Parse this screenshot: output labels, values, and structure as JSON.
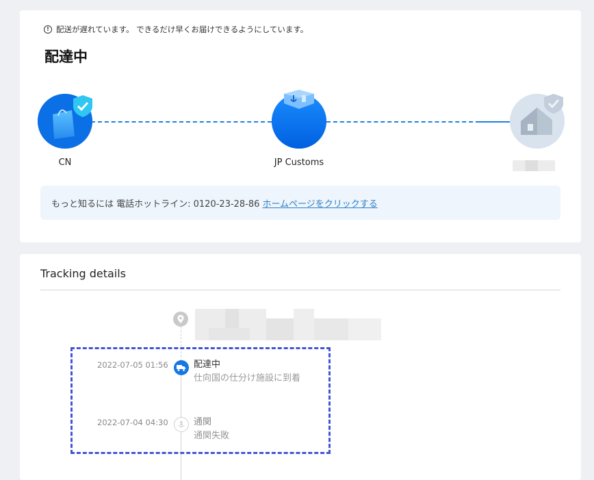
{
  "status": {
    "delay_notice": "配送が遅れています。 できるだけ早くお届けできるようにしています。",
    "title": "配達中"
  },
  "route": {
    "stops": [
      {
        "label": "CN",
        "icon": "shopping-bag-shield-icon"
      },
      {
        "label": "JP Customs",
        "icon": "customs-box-icon"
      },
      {
        "label": "",
        "icon": "house-shield-icon"
      }
    ],
    "accent_color": "#1e7fe0"
  },
  "hotline": {
    "text": "もっと知るには 電話ホットライン: 0120-23-28-86",
    "link": "ホームページをクリックする"
  },
  "tracking": {
    "title": "Tracking details",
    "events": [
      {
        "time": "2022-07-05 01:56",
        "title": "配達中",
        "desc": "仕向国の仕分け施設に到着",
        "icon": "truck-icon",
        "active": true
      },
      {
        "time": "2022-07-04 04:30",
        "title": "通関",
        "desc": "通関失敗",
        "icon": "anchor-icon",
        "active": false
      }
    ]
  }
}
